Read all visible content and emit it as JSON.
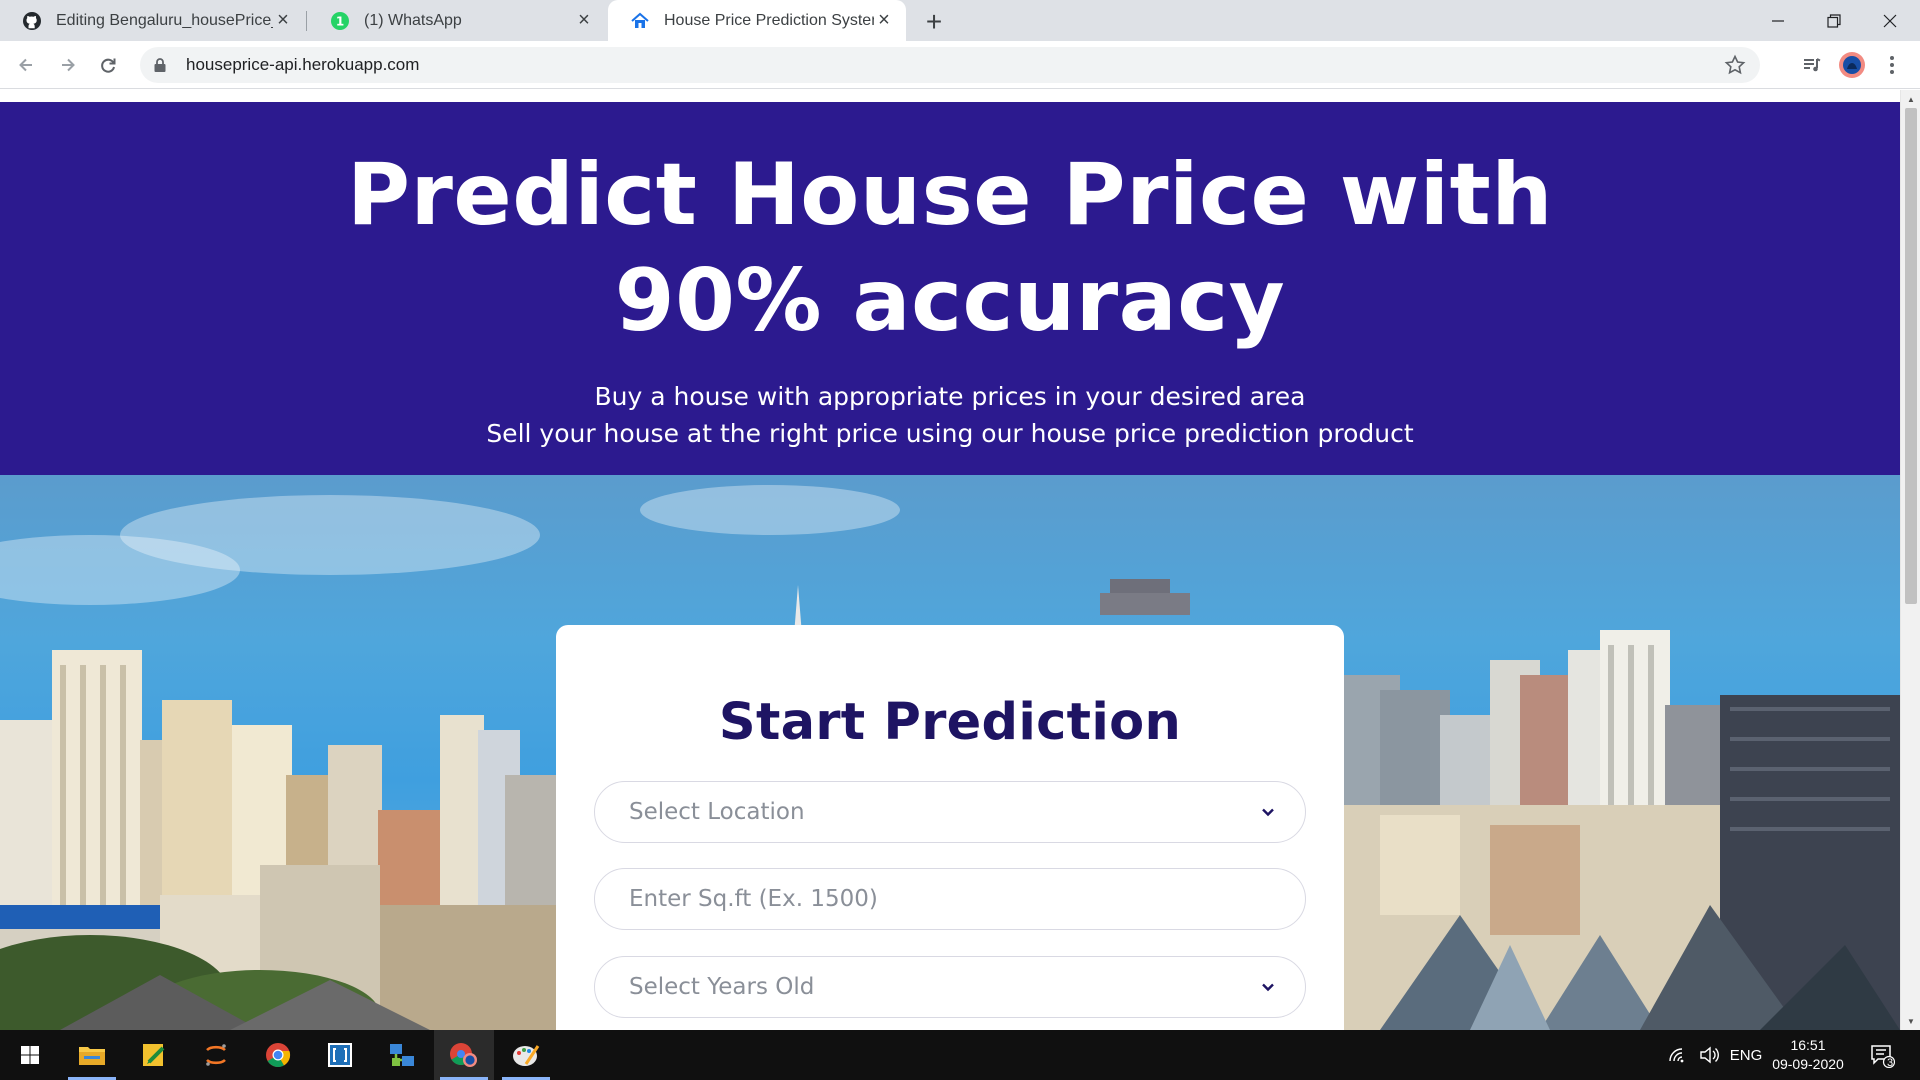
{
  "browser": {
    "tabs": [
      {
        "label": "Editing Bengaluru_housePrice_m",
        "icon": "github-icon"
      },
      {
        "label": "(1) WhatsApp",
        "icon": "whatsapp-icon"
      },
      {
        "label": "House Price Prediction System",
        "icon": "house-icon",
        "active": true
      }
    ],
    "url": "houseprice-api.herokuapp.com"
  },
  "hero": {
    "title_line1": "Predict House Price with",
    "title_line2": "90% accuracy",
    "subtitle_line1": "Buy a house with appropriate prices in your desired area",
    "subtitle_line2": "Sell your house at the right price using our house price prediction product",
    "background_color": "#2c1a8f"
  },
  "form": {
    "title": "Start Prediction",
    "location_select": "Select Location",
    "sqft_placeholder": "Enter Sq.ft (Ex. 1500)",
    "years_select": "Select Years Old",
    "title_color": "#1e1463"
  },
  "taskbar": {
    "language": "ENG",
    "time": "16:51",
    "date": "09-09-2020",
    "notifications": "3"
  }
}
